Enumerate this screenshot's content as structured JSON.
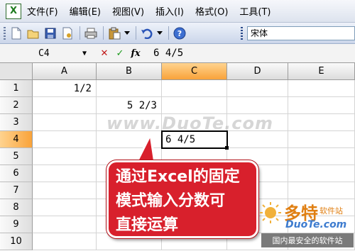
{
  "menubar": {
    "app_icon_label": "X",
    "items": [
      {
        "label": "文件(F)"
      },
      {
        "label": "编辑(E)"
      },
      {
        "label": "视图(V)"
      },
      {
        "label": "插入(I)"
      },
      {
        "label": "格式(O)"
      },
      {
        "label": "工具(T)"
      }
    ]
  },
  "toolbar": {
    "buttons": [
      "new-icon",
      "open-icon",
      "save-icon",
      "permission-icon",
      "print-icon",
      "paste-icon",
      "undo-icon",
      "help-icon"
    ],
    "font_name": "宋体"
  },
  "formula_bar": {
    "name_box": "C4",
    "cancel_glyph": "✕",
    "enter_glyph": "✓",
    "fx_label": "fx",
    "content": "6 4/5"
  },
  "grid": {
    "columns": [
      "A",
      "B",
      "C",
      "D",
      "E"
    ],
    "active_column": "C",
    "rows": [
      "1",
      "2",
      "3",
      "4",
      "5",
      "6",
      "7",
      "8",
      "9",
      "10"
    ],
    "active_row": "4",
    "cells": [
      {
        "ref": "A1",
        "value": "1/2"
      },
      {
        "ref": "B2",
        "value": "5 2/3"
      },
      {
        "ref": "C4",
        "value": "6 4/5"
      }
    ]
  },
  "watermark": "www.DuoTe.com",
  "callout": {
    "lines": [
      "通过Excel的固定",
      "模式输入分数可",
      "直接运算"
    ]
  },
  "logo": {
    "name": "多特",
    "tagline": "软件站",
    "url": "DuoTe.com",
    "slogan": "国内最安全的软件站"
  },
  "colors": {
    "active_header": "#f9a33a",
    "callout_red": "#d8202c",
    "cancel_red": "#c01818",
    "enter_green": "#1a9a1a"
  }
}
